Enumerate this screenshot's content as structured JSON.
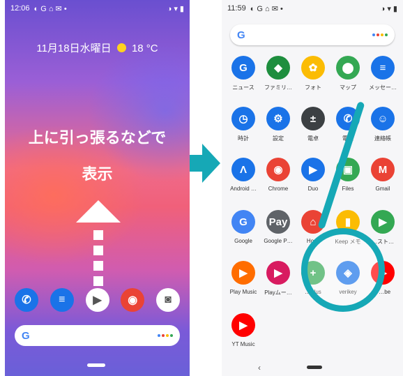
{
  "left": {
    "status_time": "12:06",
    "status_icons_left": "◐ G ⌂ ✉ •",
    "status_icons_right": "◑ ▾ ▮",
    "date_weather": "11月18日水曜日",
    "temperature": "18 °C",
    "hint_line1": "上に引っ張るなどで",
    "hint_line2": "表示",
    "search_logo": "G",
    "dock": [
      {
        "name": "phone-icon",
        "glyph": "✆",
        "color": "#1a73e8"
      },
      {
        "name": "messages-icon",
        "glyph": "≡",
        "color": "#1a73e8"
      },
      {
        "name": "play-store-icon",
        "glyph": "▶",
        "color": "#ffffff"
      },
      {
        "name": "chrome-icon",
        "glyph": "◉",
        "color": "#ea4335"
      },
      {
        "name": "camera-icon",
        "glyph": "◙",
        "color": "#ffffff"
      }
    ]
  },
  "right": {
    "status_time": "11:59",
    "status_icons_left": "◐ G ⌂ ✉ •",
    "status_icons_right": "◑ ▾ ▮",
    "search_logo": "G",
    "back_glyph": "‹",
    "apps": [
      {
        "label": "ニュース",
        "glyph": "G",
        "color": "#1a73e8"
      },
      {
        "label": "ファミリ…",
        "glyph": "◆",
        "color": "#1e8e3e"
      },
      {
        "label": "フォト",
        "glyph": "✿",
        "color": "#fbbc04"
      },
      {
        "label": "マップ",
        "glyph": "⬤",
        "color": "#34a853"
      },
      {
        "label": "メッセー…",
        "glyph": "≡",
        "color": "#1a73e8"
      },
      {
        "label": "時計",
        "glyph": "◷",
        "color": "#1a73e8"
      },
      {
        "label": "設定",
        "glyph": "⚙",
        "color": "#1a73e8"
      },
      {
        "label": "電卓",
        "glyph": "±",
        "color": "#3c4043"
      },
      {
        "label": "電話",
        "glyph": "✆",
        "color": "#1a73e8"
      },
      {
        "label": "連絡帳",
        "glyph": "☺",
        "color": "#1a73e8"
      },
      {
        "label": "Android …",
        "glyph": "Λ",
        "color": "#1a73e8"
      },
      {
        "label": "Chrome",
        "glyph": "◉",
        "color": "#ea4335"
      },
      {
        "label": "Duo",
        "glyph": "▶",
        "color": "#1a73e8"
      },
      {
        "label": "Files",
        "glyph": "▣",
        "color": "#34a853"
      },
      {
        "label": "Gmail",
        "glyph": "M",
        "color": "#ea4335"
      },
      {
        "label": "Google",
        "glyph": "G",
        "color": "#4285f4"
      },
      {
        "label": "Google P…",
        "glyph": "Pay",
        "color": "#5f6368"
      },
      {
        "label": "Ho…",
        "glyph": "⌂",
        "color": "#ea4335"
      },
      {
        "label": "Keep メモ",
        "glyph": "▮",
        "color": "#fbbc04"
      },
      {
        "label": "…スト…",
        "glyph": "▶",
        "color": "#34a853"
      },
      {
        "label": "Play Music",
        "glyph": "▶",
        "color": "#ff6d00"
      },
      {
        "label": "Playムー…",
        "glyph": "▶",
        "color": "#d81b60"
      },
      {
        "label": "…Plus",
        "glyph": "+",
        "color": "#34a853"
      },
      {
        "label": "verikey",
        "glyph": "◈",
        "color": "#1a73e8"
      },
      {
        "label": "Y…be",
        "glyph": "▶",
        "color": "#ff0000"
      },
      {
        "label": "YT Music",
        "glyph": "▶",
        "color": "#ff0000"
      }
    ]
  },
  "colors": {
    "accent": "#16a8b6"
  }
}
